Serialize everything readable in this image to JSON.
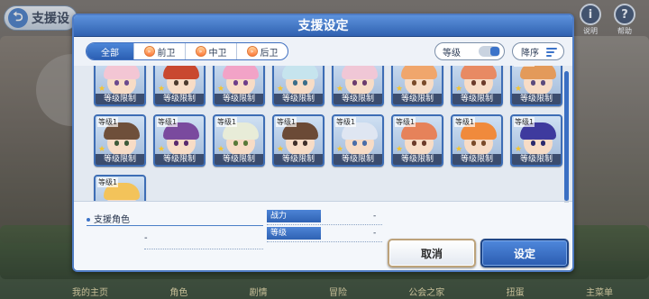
{
  "screen": {
    "back_label": "支援设",
    "right_icons": [
      {
        "label": "说明",
        "glyph": "i"
      },
      {
        "label": "帮助",
        "glyph": "?"
      }
    ],
    "bottom_menu": [
      "我的主页",
      "角色",
      "剧情",
      "冒险",
      "公会之家",
      "扭蛋",
      "主菜单"
    ]
  },
  "dialog": {
    "title": "支援设定",
    "tabs": [
      {
        "label": "全部",
        "active": true
      },
      {
        "label": "前卫",
        "active": false
      },
      {
        "label": "中卫",
        "active": false
      },
      {
        "label": "后卫",
        "active": false
      }
    ],
    "level_filter_label": "等级",
    "sort_label": "降序",
    "limit_label": "等级限制",
    "cards": [
      {
        "level": "",
        "hair": "#f3c6d4",
        "eye": "#6b4b8e"
      },
      {
        "level": "",
        "hair": "#c9482f",
        "eye": "#4b3a2e"
      },
      {
        "level": "",
        "hair": "#f2a3c7",
        "eye": "#6e3f8a"
      },
      {
        "level": "",
        "hair": "#c6e4ee",
        "eye": "#3b6e8a"
      },
      {
        "level": "",
        "hair": "#f0c7d6",
        "eye": "#6b3d6e"
      },
      {
        "level": "",
        "hair": "#f0a66c",
        "eye": "#7a4b2a"
      },
      {
        "level": "",
        "hair": "#e88a63",
        "eye": "#6b3b2a"
      },
      {
        "level": "等级1",
        "hair": "#e39a5a",
        "eye": "#5a4b7d"
      },
      {
        "level": "等级1",
        "hair": "#6e4f3a",
        "eye": "#3f5a3a"
      },
      {
        "level": "等级1",
        "hair": "#7a4a9e",
        "eye": "#5a2a6e"
      },
      {
        "level": "等级1",
        "hair": "#e8ecd8",
        "eye": "#5a7a3a"
      },
      {
        "level": "等级1",
        "hair": "#6b4a36",
        "eye": "#3f2f2a"
      },
      {
        "level": "等级1",
        "hair": "#dfe6f2",
        "eye": "#4a6ea8"
      },
      {
        "level": "等级1",
        "hair": "#e6825a",
        "eye": "#6b3b2a"
      },
      {
        "level": "等级1",
        "hair": "#f08a3c",
        "eye": "#7a4b2a"
      },
      {
        "level": "等级1",
        "hair": "#3e3a9e",
        "eye": "#2a2a6e"
      },
      {
        "level": "等级1",
        "hair": "#f3c35a",
        "eye": "#6b4b2a"
      }
    ],
    "support": {
      "title": "支援角色",
      "name": "-",
      "stats": [
        {
          "key": "战力",
          "value": "-"
        },
        {
          "key": "等级",
          "value": "-"
        }
      ]
    },
    "cancel_label": "取消",
    "confirm_label": "设定"
  },
  "colors": {
    "accent": "#3b73c9",
    "title_bar": "#2e5fae",
    "limit_band": "#1e2d50"
  }
}
